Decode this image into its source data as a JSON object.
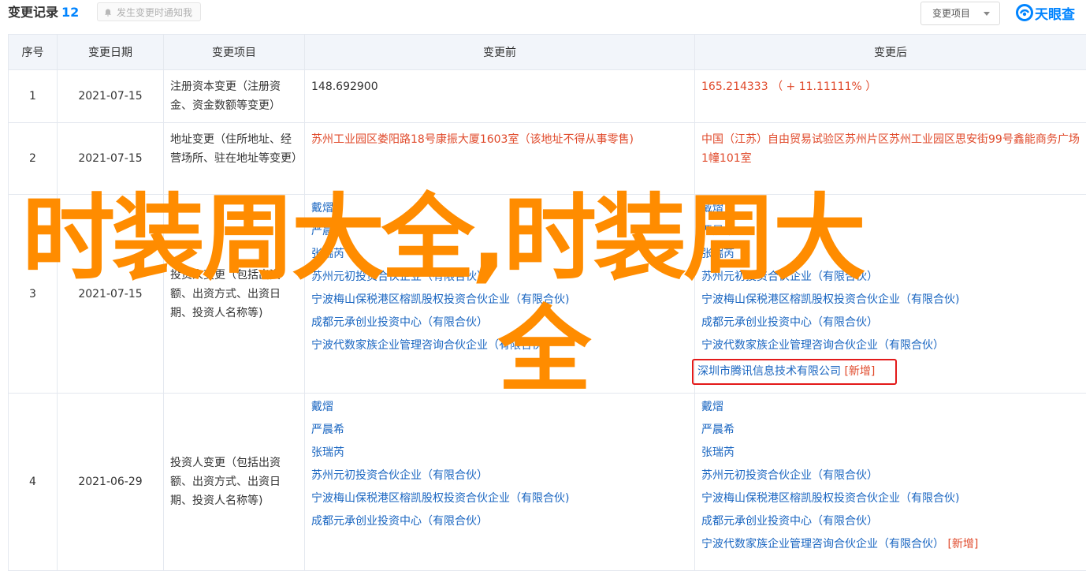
{
  "header": {
    "title": "变更记录",
    "count": "12",
    "notify_label": "发生变更时通知我",
    "filter_label": "变更项目",
    "logo_text": "天眼查"
  },
  "table": {
    "columns": [
      "序号",
      "变更日期",
      "变更项目",
      "变更前",
      "变更后"
    ],
    "rows": [
      {
        "index": "1",
        "date": "2021-07-15",
        "item": "注册资本变更（注册资金、资金数额等变更）",
        "before": "148.692900",
        "after": "165.214333 （ + 11.11111% ）"
      },
      {
        "index": "2",
        "date": "2021-07-15",
        "item": "地址变更（住所地址、经营场所、驻在地址等变更）",
        "before": "苏州工业园区娄阳路18号康振大厦1603室（该地址不得从事零售)",
        "after": "中国（江苏）自由贸易试验区苏州片区苏州工业园区思安街99号鑫能商务广场1幢101室"
      },
      {
        "index": "3",
        "date": "2021-07-15",
        "item": "投资人变更（包括出资额、出资方式、出资日期、投资人名称等)",
        "before": [
          "戴熠",
          "严晨希",
          "张瑞芮",
          "苏州元初投资合伙企业（有限合伙）",
          "宁波梅山保税港区榕凯股权投资合伙企业（有限合伙)",
          "成都元承创业投资中心（有限合伙）",
          "宁波代数家族企业管理咨询合伙企业（有限合伙）"
        ],
        "after": [
          "戴熠",
          "严晨希",
          "张瑞芮",
          "苏州元初投资合伙企业（有限合伙）",
          "宁波梅山保税港区榕凯股权投资合伙企业（有限合伙)",
          "成都元承创业投资中心（有限合伙）",
          "宁波代数家族企业管理咨询合伙企业（有限合伙）"
        ],
        "after_new": "深圳市腾讯信息技术有限公司",
        "new_tag": "[新增]"
      },
      {
        "index": "4",
        "date": "2021-06-29",
        "item": "投资人变更（包括出资额、出资方式、出资日期、投资人名称等)",
        "before": [
          "戴熠",
          "严晨希",
          "张瑞芮",
          "苏州元初投资合伙企业（有限合伙）",
          "宁波梅山保税港区榕凯股权投资合伙企业（有限合伙)",
          "成都元承创业投资中心（有限合伙）"
        ],
        "after": [
          "戴熠",
          "严晨希",
          "张瑞芮",
          "苏州元初投资合伙企业（有限合伙）",
          "宁波梅山保税港区榕凯股权投资合伙企业（有限合伙)",
          "成都元承创业投资中心（有限合伙）"
        ],
        "after_new": "宁波代数家族企业管理咨询合伙企业（有限合伙）",
        "new_tag": "[新增]"
      }
    ]
  },
  "overlay": {
    "line1": "时装周大全,时装周大",
    "line2": "全"
  },
  "colors": {
    "accent": "#0084ff",
    "link": "#1a66c1",
    "changed": "#e04a2b",
    "header_bg": "#f2f5fa",
    "overlay": "#ff8c00",
    "highlight": "#e31a1a"
  }
}
